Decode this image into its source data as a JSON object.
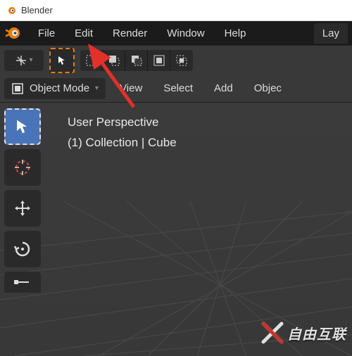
{
  "titlebar": {
    "app_name": "Blender"
  },
  "menubar": {
    "file": "File",
    "edit": "Edit",
    "render": "Render",
    "window": "Window",
    "help": "Help",
    "layout_tab": "Lay"
  },
  "toolbar2": {
    "mode_label": "Object Mode",
    "view": "View",
    "select": "Select",
    "add": "Add",
    "object": "Objec"
  },
  "viewport": {
    "perspective_label": "User Perspective",
    "context_label": "(1) Collection | Cube"
  },
  "icons": {
    "pivot": "pivot-icon",
    "cursor": "cursor-icon",
    "select_new": "select-new-icon",
    "select_extend": "select-extend-icon",
    "select_subtract": "select-subtract-icon",
    "select_invert": "select-invert-icon",
    "select_intersect": "select-intersect-icon",
    "mode": "object-mode-icon",
    "tool_select": "select-box-tool-icon",
    "tool_cursor": "cursor-tool-icon",
    "tool_move": "move-tool-icon",
    "tool_rotate": "rotate-tool-icon",
    "tool_scale": "scale-tool-icon"
  },
  "colors": {
    "accent_orange": "#e87d0d",
    "active_blue": "#4a74b8",
    "arrow_red": "#e3302a"
  },
  "watermark": {
    "text": "自由互联"
  }
}
